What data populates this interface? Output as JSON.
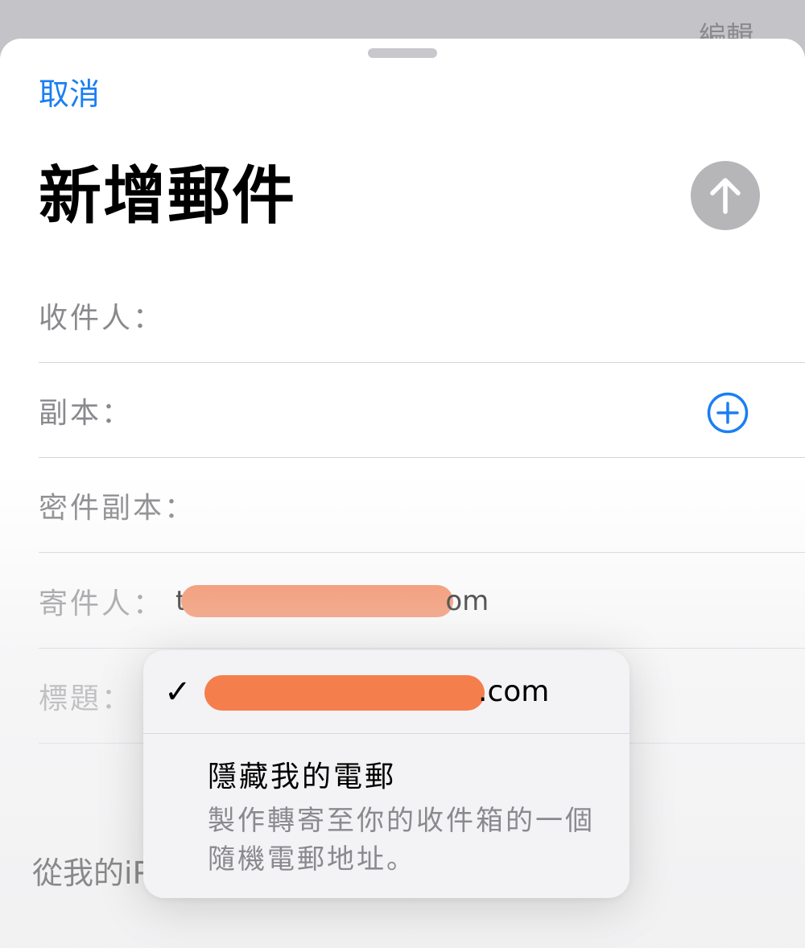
{
  "background": {
    "edit_label": "編輯"
  },
  "header": {
    "cancel_label": "取消",
    "title": "新增郵件",
    "send_icon": "arrow-up-icon"
  },
  "fields": {
    "to_label": "收件人：",
    "cc_label": "副本：",
    "cc_add_icon": "plus-circle-icon",
    "bcc_label": "密件副本：",
    "from_label": "寄件人：",
    "from_value_start": "t",
    "from_value_end": "om",
    "subject_label": "標題："
  },
  "from_menu": {
    "check_mark": "✓",
    "address_suffix": ".com",
    "hide_title": "隱藏我的電郵",
    "hide_description": "製作轉寄至你的收件箱的一個隨機電郵地址。"
  },
  "body": {
    "from_note_partial": "從我的iP"
  },
  "colors": {
    "accent": "#1a7ff2",
    "redaction": "#f57e4d",
    "send_disabled": "#b6b6b9"
  }
}
